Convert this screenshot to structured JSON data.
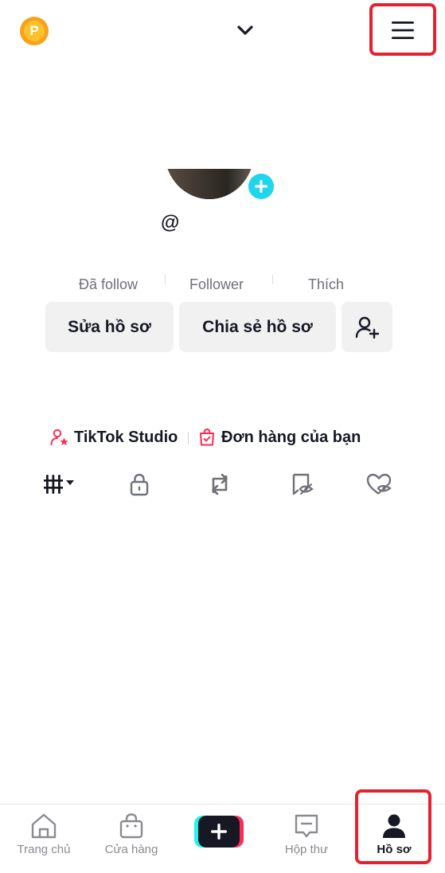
{
  "topbar": {
    "coin_icon": "tiktok-coin-icon",
    "coin_letter": "P",
    "account_switch_icon": "chevron-down-icon",
    "menu_icon": "hamburger-menu-icon"
  },
  "profile": {
    "avatar_add_icon": "plus-icon",
    "username_prefix": "@"
  },
  "stats": {
    "following_label": "Đã follow",
    "followers_label": "Follower",
    "likes_label": "Thích"
  },
  "actions": {
    "edit_profile": "Sửa hồ sơ",
    "share_profile": "Chia sẻ hồ sơ",
    "add_friend_icon": "add-user-icon"
  },
  "shortcuts": {
    "studio": "TikTok Studio",
    "orders": "Đơn hàng của bạn"
  },
  "tabs": [
    {
      "icon": "videos-grid-icon"
    },
    {
      "icon": "lock-icon"
    },
    {
      "icon": "repost-icon"
    },
    {
      "icon": "favorites-hidden-icon"
    },
    {
      "icon": "liked-hidden-icon"
    }
  ],
  "bottom_nav": {
    "home": "Trang chủ",
    "shop": "Cửa hàng",
    "create_icon": "plus-icon",
    "inbox": "Hộp thư",
    "profile": "Hồ sơ"
  },
  "colors": {
    "highlight": "#e4222f",
    "accent_cyan": "#20d5ec",
    "accent_red": "#fe2c55",
    "coin": "#f7a21c"
  }
}
